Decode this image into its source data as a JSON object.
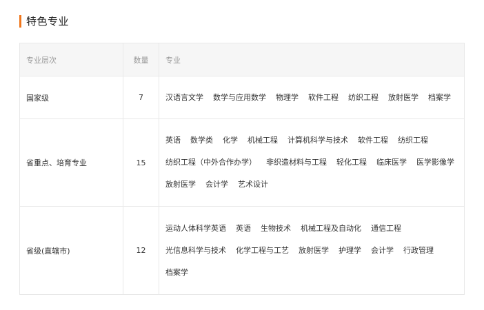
{
  "section": {
    "title": "特色专业"
  },
  "table": {
    "headers": {
      "level": "专业层次",
      "count": "数量",
      "majors": "专业"
    },
    "rows": [
      {
        "level": "国家级",
        "count": "7",
        "lines": [
          [
            "汉语言文学",
            "数学与应用数学",
            "物理学",
            "软件工程",
            "纺织工程",
            "放射医学",
            "档案学"
          ]
        ]
      },
      {
        "level": "省重点、培育专业",
        "count": "15",
        "lines": [
          [
            "英语",
            "数学类",
            "化学",
            "机械工程",
            "计算机科学与技术",
            "软件工程",
            "纺织工程"
          ],
          [
            "纺织工程（中外合作办学）",
            "非织造材料与工程",
            "轻化工程",
            "临床医学",
            "医学影像学"
          ],
          [
            "放射医学",
            "会计学",
            "艺术设计"
          ]
        ]
      },
      {
        "level": "省级(直辖市)",
        "count": "12",
        "lines": [
          [
            "运动人体科学英语",
            "英语",
            "生物技术",
            "机械工程及自动化",
            "通信工程"
          ],
          [
            "光信息科学与技术",
            "化学工程与工艺",
            "放射医学",
            "护理学",
            "会计学",
            "行政管理"
          ],
          [
            "档案学"
          ]
        ]
      }
    ]
  },
  "colors": {
    "accent": "#f0761c",
    "header_bg": "#f6f6f6",
    "border": "#e8e8e8"
  }
}
